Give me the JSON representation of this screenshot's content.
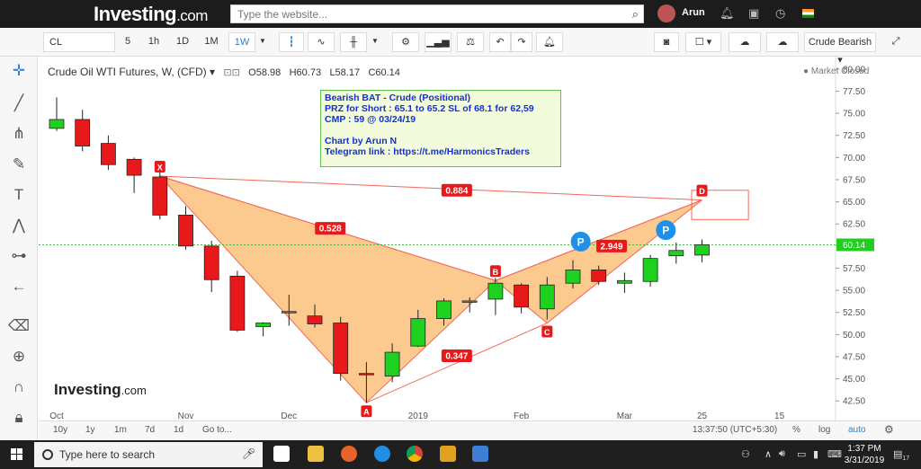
{
  "header": {
    "logo_main": "Investing",
    "logo_suffix": ".com",
    "search_placeholder": "Type the website...",
    "user_name": "Arun"
  },
  "toolbar": {
    "symbol": "CL",
    "intervals": [
      "5",
      "1h",
      "1D",
      "1M",
      "1W"
    ],
    "selected_interval": "1W",
    "template_label": "Crude Bearish"
  },
  "legend": {
    "title": "Crude Oil WTI Futures, W, (CFD)",
    "open": "O58.98",
    "high": "H60.73",
    "low": "L58.17",
    "close": "C60.14",
    "market_status": "Market Closed"
  },
  "note": {
    "line1": "Bearish BAT  - Crude (Positional)",
    "line2": "PRZ for Short : 65.1 to 65.2  SL of 68.1 for 62,59",
    "line3": "CMP : 59 @ 03/24/19",
    "line4": "Chart by Arun N",
    "line5": "Telegram link : https://t.me/HarmonicsTraders"
  },
  "watermark": {
    "main": "Investing",
    "suffix": ".com"
  },
  "bottom": {
    "ranges": [
      "10y",
      "1y",
      "1m",
      "7d",
      "1d"
    ],
    "goto": "Go to...",
    "time": "13:37:50 (UTC+5:30)",
    "percent": "%",
    "log": "log",
    "auto": "auto"
  },
  "taskbar": {
    "search_text": "Type here to search",
    "time": "1:37 PM",
    "date": "3/31/2019",
    "notif_count": "17"
  },
  "chart_data": {
    "type": "candlestick",
    "ylim": [
      41,
      81
    ],
    "y_ticks": [
      42.5,
      45.0,
      47.5,
      50.0,
      52.5,
      55.0,
      57.5,
      60.0,
      62.5,
      65.0,
      67.5,
      70.0,
      72.5,
      75.0,
      77.5,
      80.0
    ],
    "y_tick_labels": [
      "42.50",
      "45.00",
      "47.50",
      "50.00",
      "52.50",
      "55.00",
      "57.50",
      "60.00",
      "62.50",
      "65.00",
      "67.50",
      "70.00",
      "72.50",
      "75.00",
      "77.50",
      "80.00"
    ],
    "last_price": 60.14,
    "last_price_label": "60.14",
    "x_labels": [
      {
        "label": "Oct",
        "index": 0
      },
      {
        "label": "Nov",
        "index": 5
      },
      {
        "label": "Dec",
        "index": 9
      },
      {
        "label": "2019",
        "index": 14
      },
      {
        "label": "Feb",
        "index": 18
      },
      {
        "label": "Mar",
        "index": 22
      },
      {
        "label": "25",
        "index": 25
      },
      {
        "label": "15",
        "index": 28
      }
    ],
    "candles": [
      {
        "o": 73.3,
        "h": 76.8,
        "l": 73.0,
        "c": 74.3
      },
      {
        "o": 74.3,
        "h": 75.4,
        "l": 70.7,
        "c": 71.3
      },
      {
        "o": 71.6,
        "h": 72.5,
        "l": 68.6,
        "c": 69.2
      },
      {
        "o": 69.8,
        "h": 70.0,
        "l": 66.0,
        "c": 68.0
      },
      {
        "o": 67.8,
        "h": 68.5,
        "l": 63.0,
        "c": 63.5
      },
      {
        "o": 63.5,
        "h": 64.5,
        "l": 59.6,
        "c": 60.0
      },
      {
        "o": 60.0,
        "h": 60.6,
        "l": 54.8,
        "c": 56.2
      },
      {
        "o": 56.6,
        "h": 57.2,
        "l": 50.3,
        "c": 50.5
      },
      {
        "o": 50.9,
        "h": 51.4,
        "l": 49.8,
        "c": 51.3
      },
      {
        "o": 52.5,
        "h": 54.5,
        "l": 51.0,
        "c": 52.6
      },
      {
        "o": 52.1,
        "h": 53.4,
        "l": 50.8,
        "c": 51.2
      },
      {
        "o": 51.3,
        "h": 52.0,
        "l": 44.8,
        "c": 45.6
      },
      {
        "o": 45.6,
        "h": 46.9,
        "l": 42.3,
        "c": 45.5
      },
      {
        "o": 45.3,
        "h": 49.0,
        "l": 44.6,
        "c": 48.0
      },
      {
        "o": 48.7,
        "h": 52.8,
        "l": 48.6,
        "c": 51.8
      },
      {
        "o": 51.8,
        "h": 54.1,
        "l": 51.0,
        "c": 53.8
      },
      {
        "o": 53.7,
        "h": 54.2,
        "l": 52.5,
        "c": 53.8
      },
      {
        "o": 54.0,
        "h": 56.4,
        "l": 52.2,
        "c": 55.8
      },
      {
        "o": 55.6,
        "h": 55.8,
        "l": 52.4,
        "c": 53.1
      },
      {
        "o": 52.9,
        "h": 56.5,
        "l": 51.7,
        "c": 55.6
      },
      {
        "o": 55.8,
        "h": 58.4,
        "l": 55.2,
        "c": 57.3
      },
      {
        "o": 57.3,
        "h": 57.8,
        "l": 55.6,
        "c": 56.0
      },
      {
        "o": 55.8,
        "h": 57.0,
        "l": 54.7,
        "c": 56.1
      },
      {
        "o": 56.0,
        "h": 59.0,
        "l": 55.4,
        "c": 58.6
      },
      {
        "o": 58.9,
        "h": 60.4,
        "l": 58.0,
        "c": 59.5
      },
      {
        "o": 58.98,
        "h": 60.73,
        "l": 58.17,
        "c": 60.14
      }
    ],
    "pattern": {
      "points": [
        {
          "label": "X",
          "index": 4,
          "price": 67.9
        },
        {
          "label": "A",
          "index": 12,
          "price": 42.3
        },
        {
          "label": "B",
          "index": 17,
          "price": 56.1
        },
        {
          "label": "C",
          "index": 19,
          "price": 51.3
        },
        {
          "label": "D",
          "index": 25,
          "price": 65.2
        }
      ],
      "ratios": [
        {
          "label": "0.884",
          "index": 15.5,
          "price": 66.3
        },
        {
          "label": "0.528",
          "index": 10.6,
          "price": 62.0
        },
        {
          "label": "0.347",
          "index": 15.5,
          "price": 47.6
        },
        {
          "label": "2.949",
          "index": 21.5,
          "price": 60.0
        }
      ],
      "markers": [
        {
          "label": "P",
          "index": 20.3,
          "price": 60.5
        },
        {
          "label": "P",
          "index": 23.6,
          "price": 61.8
        }
      ],
      "prz_box": {
        "index_start": 24.6,
        "index_end": 26.8,
        "top": 66.3,
        "bottom": 63.0
      }
    }
  }
}
